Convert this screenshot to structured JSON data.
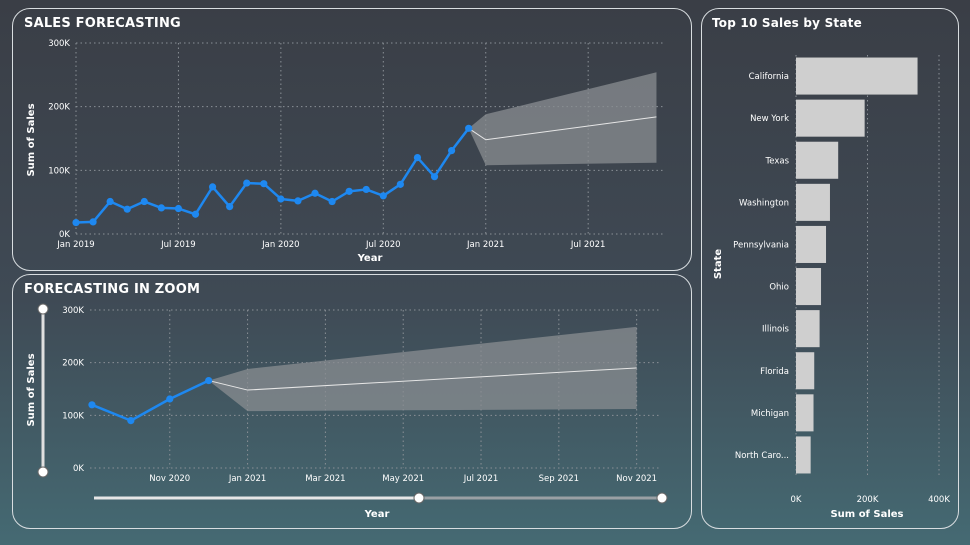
{
  "colors": {
    "series": "#1e88f0",
    "forecast_band": "#8a8e92",
    "forecast_line": "#e6e6e6",
    "bar": "#cfcfcf",
    "grid": "#8a9096"
  },
  "panels": {
    "forecast_title": "SALES FORECASTING",
    "zoom_title": "FORECASTING IN ZOOM",
    "states_title": "Top 10 Sales by State"
  },
  "chart_data": [
    {
      "type": "line",
      "title": "SALES FORECASTING",
      "xlabel": "Year",
      "ylabel": "Sum of Sales",
      "y_ticks": [
        "0K",
        "100K",
        "200K",
        "300K"
      ],
      "ylim": [
        0,
        300000
      ],
      "x_ticks": [
        "Jan 2019",
        "Jul 2019",
        "Jan 2020",
        "Jul 2020",
        "Jan 2021",
        "Jul 2021"
      ],
      "x": [
        "2019-01",
        "2019-02",
        "2019-03",
        "2019-04",
        "2019-05",
        "2019-06",
        "2019-07",
        "2019-08",
        "2019-09",
        "2019-10",
        "2019-11",
        "2019-12",
        "2020-01",
        "2020-02",
        "2020-03",
        "2020-04",
        "2020-05",
        "2020-06",
        "2020-07",
        "2020-08",
        "2020-09",
        "2020-10",
        "2020-11",
        "2020-12"
      ],
      "values": [
        18000,
        19000,
        51000,
        39000,
        51000,
        41000,
        40000,
        31000,
        74000,
        43000,
        80000,
        79000,
        55000,
        52000,
        64000,
        51000,
        67000,
        70000,
        60000,
        78000,
        120000,
        90000,
        131000,
        166000
      ],
      "forecast": {
        "x": [
          "2020-12",
          "2021-01",
          "2021-11"
        ],
        "values": [
          166000,
          148000,
          184000
        ],
        "lower": [
          166000,
          108000,
          112000
        ],
        "upper": [
          166000,
          188000,
          254000
        ]
      },
      "grid": true
    },
    {
      "type": "line",
      "title": "FORECASTING IN ZOOM",
      "xlabel": "Year",
      "ylabel": "Sum of Sales",
      "y_ticks": [
        "0K",
        "100K",
        "200K",
        "300K"
      ],
      "ylim": [
        0,
        300000
      ],
      "x_ticks": [
        "Nov 2020",
        "Jan 2021",
        "Mar 2021",
        "May 2021",
        "Jul 2021",
        "Sep 2021",
        "Nov 2021"
      ],
      "x": [
        "2020-09",
        "2020-10",
        "2020-11",
        "2020-12"
      ],
      "values": [
        120000,
        90000,
        131000,
        166000
      ],
      "forecast": {
        "x": [
          "2020-12",
          "2021-01",
          "2021-11"
        ],
        "values": [
          166000,
          148000,
          190000
        ],
        "lower": [
          166000,
          108000,
          112000
        ],
        "upper": [
          166000,
          188000,
          268000
        ]
      },
      "grid": true
    },
    {
      "type": "bar",
      "orientation": "horizontal",
      "title": "Top 10 Sales by State",
      "xlabel": "Sum of Sales",
      "ylabel": "State",
      "categories": [
        "California",
        "New York",
        "Texas",
        "Washington",
        "Pennsylvania",
        "Ohio",
        "Illinois",
        "Florida",
        "Michigan",
        "North Caro..."
      ],
      "values": [
        340000,
        192000,
        118000,
        95000,
        84000,
        70000,
        66000,
        51000,
        49000,
        41000
      ],
      "x_ticks": [
        "0K",
        "200K",
        "400K"
      ],
      "xlim": [
        0,
        400000
      ],
      "grid": true
    }
  ]
}
